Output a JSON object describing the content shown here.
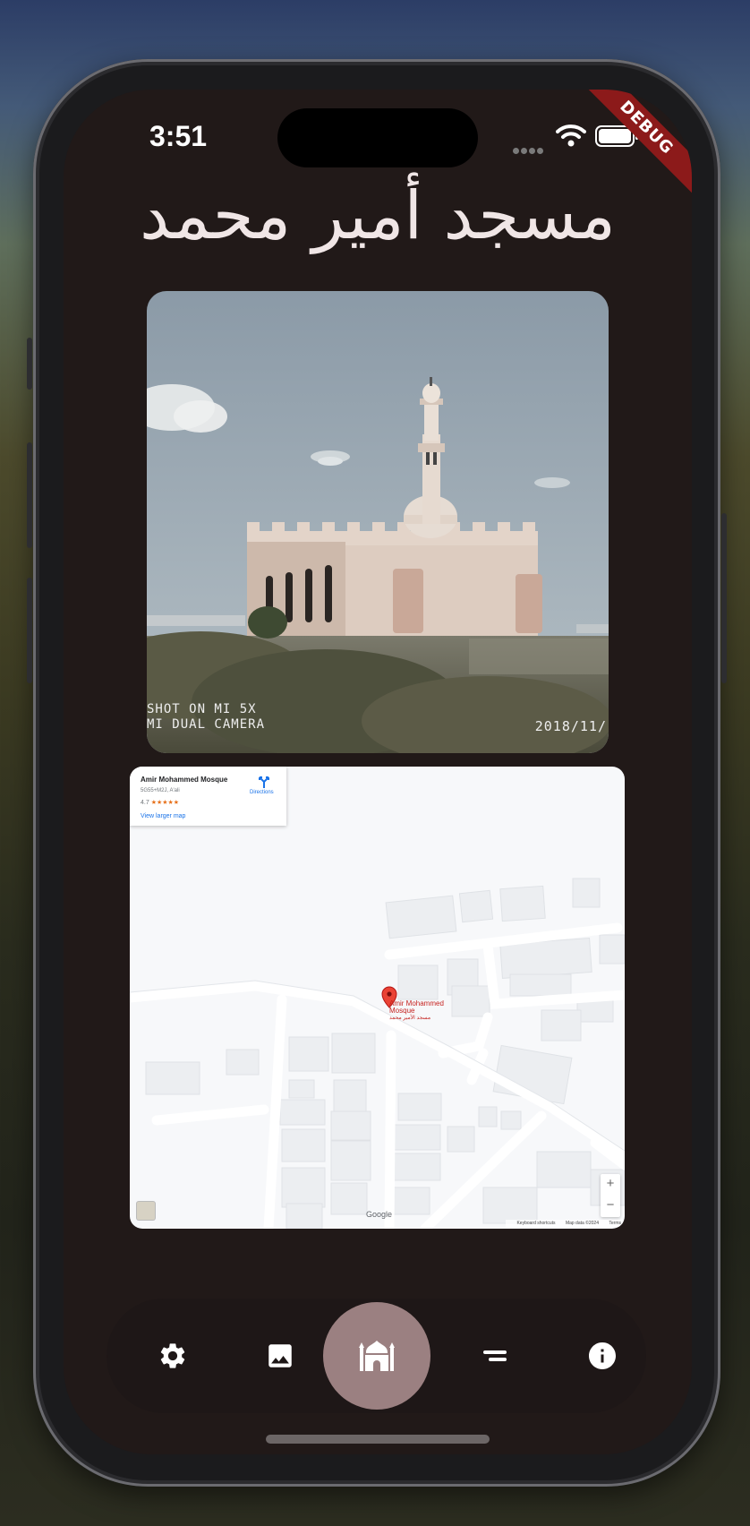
{
  "status_bar": {
    "time": "3:51"
  },
  "debug_banner": {
    "label": "DEBUG"
  },
  "header": {
    "title": "مسجد أمير محمد"
  },
  "photo": {
    "caption_line1": "SHOT ON MI 5X",
    "caption_line2": "MI DUAL CAMERA",
    "date_stamp": "2018/11/"
  },
  "map": {
    "place_name": "Amir Mohammed Mosque",
    "plus_code": "5G55+M2J, A'ali",
    "rating": "4.7",
    "stars": "★★★★★",
    "directions_label": "Directions",
    "larger_map_link": "View larger map",
    "pin_label_line1": "Amir Mohammed",
    "pin_label_line2": "Mosque",
    "pin_label_line3": "مسجد الأمير محمد",
    "zoom_in": "+",
    "zoom_out": "−",
    "footer_shortcuts": "Keyboard shortcuts",
    "footer_data": "Map data ©2024",
    "footer_terms": "Terms",
    "logo": "Google"
  },
  "bottom_nav": {
    "items": [
      {
        "icon": "gear-icon"
      },
      {
        "icon": "image-icon"
      },
      {
        "icon": "mosque-icon",
        "selected": true
      },
      {
        "icon": "list-icon"
      },
      {
        "icon": "info-icon"
      }
    ],
    "selected_color": "#9b8081"
  },
  "colors": {
    "background": "#211918",
    "debug": "#8c1a1a",
    "title": "#f0e6e6"
  }
}
